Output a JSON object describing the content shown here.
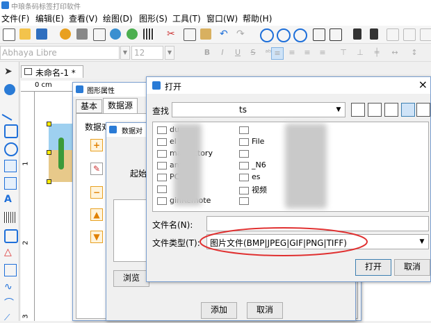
{
  "app": {
    "title": "中琅条码标签打印软件"
  },
  "menu": {
    "items": [
      "文件(F)",
      "编辑(E)",
      "查看(V)",
      "绘图(D)",
      "图形(S)",
      "工具(T)",
      "窗口(W)",
      "帮助(H)"
    ]
  },
  "format_bar": {
    "font_name": "Abhaya Libre",
    "font_size": "12",
    "bold": "B",
    "italic": "I",
    "underline": "U",
    "strike": "S"
  },
  "document": {
    "tab_label": "未命名-1 *",
    "ruler_unit": "0 cm",
    "ruler_1": "1",
    "ruler_2": "2",
    "ruler_3": "3"
  },
  "shape_props_dialog": {
    "title": "图形属性",
    "tabs": [
      "基本",
      "数据源"
    ],
    "data_object_label": "数据对",
    "browse_button": "浏览"
  },
  "data_object_dialog": {
    "title": "数据对",
    "start_label": "起始",
    "add_button": "添加",
    "cancel_button": "取消"
  },
  "open_dialog": {
    "title": "打开",
    "look_in_label": "查找",
    "look_in_value": "ts",
    "files_col1": [
      "du",
      "el",
      "matFactory",
      "am",
      "PCMgr",
      "",
      "ginRemote"
    ],
    "files_col2": [
      "",
      "File",
      "",
      "_N6",
      "es",
      "视频",
      ""
    ],
    "filename_label": "文件名(N):",
    "filename_value": "",
    "filetype_label": "文件类型(T):",
    "filetype_value": "图片文件(BMP|JPEG|GIF|PNG|TIFF)",
    "open_button": "打开",
    "cancel_button": "取消",
    "close_glyph": "×"
  },
  "colors": {
    "highlight_ellipse": "#e03030",
    "dialog_border": "#7a9fd0",
    "accent_blue": "#1e6fd9"
  }
}
